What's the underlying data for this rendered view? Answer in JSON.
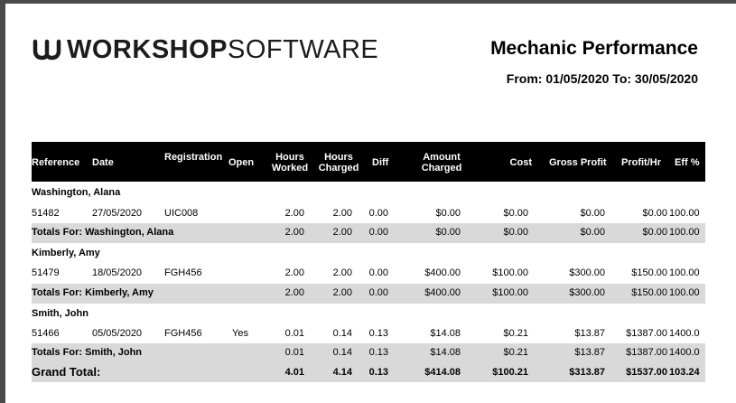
{
  "brand": {
    "bold": "WORKSHOP",
    "light": "SOFTWARE"
  },
  "report": {
    "title": "Mechanic Performance",
    "range": "From: 01/05/2020 To: 30/05/2020"
  },
  "columns": {
    "reference": "Reference",
    "date": "Date",
    "registration": "Registration",
    "open": "Open",
    "hours_worked": [
      "Hours",
      "Worked"
    ],
    "hours_charged": [
      "Hours",
      "Charged"
    ],
    "diff": "Diff",
    "amount_charged": [
      "Amount",
      "Charged"
    ],
    "cost": "Cost",
    "gross_profit": "Gross Profit",
    "profit_hr": "Profit/Hr",
    "eff": "Eff %"
  },
  "groups": [
    {
      "name": "Washington, Alana",
      "rows": [
        {
          "reference": "51482",
          "date": "27/05/2020",
          "registration": "UIC008",
          "open": "",
          "hours_worked": "2.00",
          "hours_charged": "2.00",
          "diff": "0.00",
          "amount_charged": "$0.00",
          "cost": "$0.00",
          "gross_profit": "$0.00",
          "profit_hr": "$0.00",
          "eff": "100.00"
        }
      ],
      "total": {
        "label": "Totals For: Washington, Alana",
        "hours_worked": "2.00",
        "hours_charged": "2.00",
        "diff": "0.00",
        "amount_charged": "$0.00",
        "cost": "$0.00",
        "gross_profit": "$0.00",
        "profit_hr": "$0.00",
        "eff": "100.00"
      }
    },
    {
      "name": "Kimberly, Amy",
      "rows": [
        {
          "reference": "51479",
          "date": "18/05/2020",
          "registration": "FGH456",
          "open": "",
          "hours_worked": "2.00",
          "hours_charged": "2.00",
          "diff": "0.00",
          "amount_charged": "$400.00",
          "cost": "$100.00",
          "gross_profit": "$300.00",
          "profit_hr": "$150.00",
          "eff": "100.00"
        }
      ],
      "total": {
        "label": "Totals For: Kimberly, Amy",
        "hours_worked": "2.00",
        "hours_charged": "2.00",
        "diff": "0.00",
        "amount_charged": "$400.00",
        "cost": "$100.00",
        "gross_profit": "$300.00",
        "profit_hr": "$150.00",
        "eff": "100.00"
      }
    },
    {
      "name": "Smith, John",
      "rows": [
        {
          "reference": "51466",
          "date": "05/05/2020",
          "registration": "FGH456",
          "open": "Yes",
          "hours_worked": "0.01",
          "hours_charged": "0.14",
          "diff": "0.13",
          "amount_charged": "$14.08",
          "cost": "$0.21",
          "gross_profit": "$13.87",
          "profit_hr": "$1387.00",
          "eff": "1400.0"
        }
      ],
      "total": {
        "label": "Totals For: Smith, John",
        "hours_worked": "0.01",
        "hours_charged": "0.14",
        "diff": "0.13",
        "amount_charged": "$14.08",
        "cost": "$0.21",
        "gross_profit": "$13.87",
        "profit_hr": "$1387.00",
        "eff": "1400.0"
      }
    }
  ],
  "grand_total": {
    "label": "Grand Total:",
    "hours_worked": "4.01",
    "hours_charged": "4.14",
    "diff": "0.13",
    "amount_charged": "$414.08",
    "cost": "$100.21",
    "gross_profit": "$313.87",
    "profit_hr": "$1537.00",
    "eff": "103.24"
  }
}
